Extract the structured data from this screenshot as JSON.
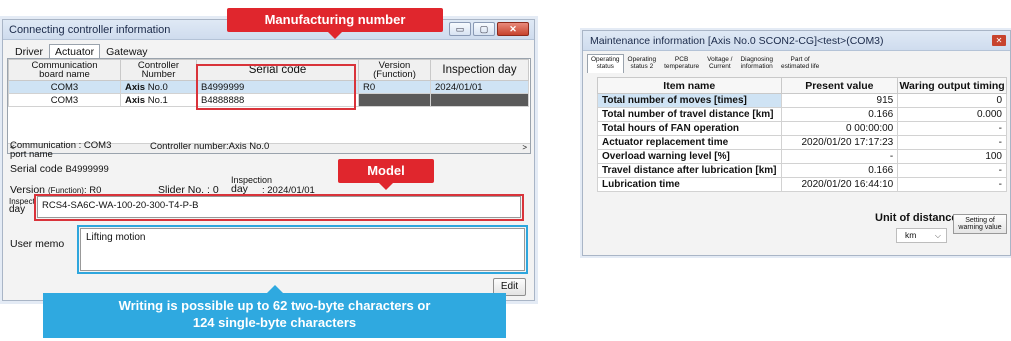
{
  "left_window": {
    "title": "Connecting controller information",
    "controls": {
      "minimize": "▭",
      "maximize": "▢",
      "close": "✕"
    },
    "tabs": [
      "Driver",
      "Actuator",
      "Gateway"
    ],
    "active_tab": "Actuator",
    "table": {
      "headers": {
        "comm_line1": "Communication",
        "comm_line2": "board name",
        "controller_number": "Controller Number",
        "serial_code": "Serial code",
        "version": "Version (Function)",
        "inspection_day": "Inspection day"
      },
      "rows": [
        {
          "comm": "COM3",
          "axis_label": "Axis",
          "axis_no": "No.0",
          "serial": "B4999999",
          "version": "R0",
          "inspection": "2024/01/01"
        },
        {
          "comm": "COM3",
          "axis_label": "Axis",
          "axis_no": "No.1",
          "serial": "B4888888",
          "version": "",
          "inspection": ""
        }
      ],
      "scroll_left": "<",
      "scroll_right": ">"
    },
    "details": {
      "comm_port_line1": "Communication",
      "comm_port_colon": ": COM3",
      "comm_port_line2": "port name",
      "controller_number_label": "Controller number:",
      "controller_number_value": "Axis No.0",
      "serial_code_label": "Serial code",
      "serial_code_value": "B4999999",
      "version_label": "Version",
      "version_func": "(Function)",
      "version_value": ": R0",
      "slider_label": "Slider No. : 0",
      "inspection_label_1": "Inspection",
      "inspection_label_2": "day",
      "inspection_value": ": 2024/01/01",
      "model_label_1": "Inspection",
      "model_label_2": "day",
      "model_value": "RCS4-SA6C-WA-100-20-300-T4-P-B",
      "user_memo_label": "User memo",
      "user_memo_value": "Lifting motion",
      "edit_button": "Edit"
    }
  },
  "callouts": {
    "manufacturing_number": "Manufacturing number",
    "model": "Model",
    "writing_line1": "Writing is possible up to 62 two-byte characters or",
    "writing_line2": "124 single-byte characters"
  },
  "right_window": {
    "title": "Maintenance information [Axis No.0 SCON2-CG]<test>(COM3)",
    "close": "✕",
    "tabs": [
      {
        "l1": "Operating",
        "l2": "status"
      },
      {
        "l1": "Operating",
        "l2": "status 2"
      },
      {
        "l1": "PCB",
        "l2": "temperature"
      },
      {
        "l1": "Voltage /",
        "l2": "Current"
      },
      {
        "l1": "Diagnosing",
        "l2": "information"
      },
      {
        "l1": "Part of",
        "l2": "estimated life"
      }
    ],
    "headers": {
      "item": "Item name",
      "present": "Present value",
      "warning": "Waring output timing"
    },
    "rows": [
      {
        "name": "Total number of moves [times]",
        "present": "915",
        "warning": "0"
      },
      {
        "name": "Total number of travel distance [km]",
        "present": "0.166",
        "warning": "0.000"
      },
      {
        "name": "Total hours of FAN operation",
        "present": "0 00:00:00",
        "warning": "-"
      },
      {
        "name": "Actuator replacement time",
        "present": "2020/01/20 17:17:23",
        "warning": "-"
      },
      {
        "name": "Overload warning level [%]",
        "present": "-",
        "warning": "100"
      },
      {
        "name": "Travel distance after lubrication [km]",
        "present": "0.166",
        "warning": "-"
      },
      {
        "name": "Lubrication time",
        "present": "2020/01/20 16:44:10",
        "warning": "-"
      }
    ],
    "unit_label": "Unit of distance",
    "unit_value": "km",
    "setting_btn_1": "Setting of",
    "setting_btn_2": "warning value"
  },
  "colors": {
    "red": "#e0262d",
    "blue": "#2fa9e0",
    "selected_row": "#cfe3f4"
  },
  "icons": {
    "chevron": "chevron-down-icon"
  }
}
